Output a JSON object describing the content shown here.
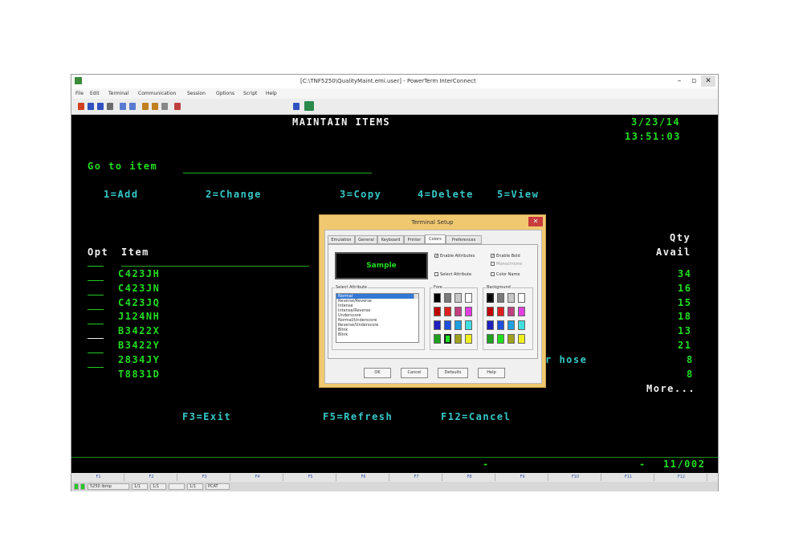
{
  "window": {
    "title": "[C:\\TNF5250\\QualityMaint.emi.user] - PowerTerm InterConnect",
    "minimize_glyph": "–",
    "restore_glyph": "▫",
    "close_glyph": "✕"
  },
  "menubar": [
    "File",
    "Edit",
    "Terminal",
    "Communication",
    "Session",
    "Options",
    "Script",
    "Help"
  ],
  "toolbar": {
    "buttons": [
      {
        "icon": "open-icon",
        "color": "#d04020"
      },
      {
        "icon": "connect-icon",
        "color": "#3050c0"
      },
      {
        "icon": "disconnect-icon",
        "color": "#3050c0"
      },
      {
        "icon": "print-icon",
        "color": "#6a6a6a"
      },
      {
        "icon": "copy-icon",
        "color": "#5a7ad0"
      },
      {
        "icon": "paste-icon",
        "color": "#5a7ad0"
      },
      {
        "icon": "receive-file-icon",
        "color": "#c08020"
      },
      {
        "icon": "send-file-icon",
        "color": "#c08020"
      },
      {
        "icon": "transfer-icon",
        "color": "#888888"
      },
      {
        "icon": "settings-icon",
        "color": "#c04040"
      },
      {
        "icon": "macro-icon",
        "color": "#3050c0"
      },
      {
        "icon": "keyboard-map-icon",
        "color": "#2a8a4a"
      }
    ]
  },
  "screen": {
    "title": "MAINTAIN ITEMS",
    "date": "3/23/14",
    "time": "13:51:03",
    "position_label": "Go to item",
    "options": [
      "1=Add",
      "2=Change",
      "3=Copy",
      "4=Delete",
      "5=View"
    ],
    "header_opt": "Opt",
    "header_item": "Item",
    "header_qty": "Qty",
    "header_avail": "Avail",
    "rows": [
      {
        "item": "C423JH",
        "qty": "34"
      },
      {
        "item": "C423JN",
        "qty": "16"
      },
      {
        "item": "C423JQ",
        "qty": "15"
      },
      {
        "item": "J124NH",
        "qty": "18"
      },
      {
        "item": "B3422X",
        "qty": "13"
      },
      {
        "item": "B3422Y",
        "qty": "21"
      },
      {
        "item": "2834JY",
        "qty": "8"
      },
      {
        "item": "T8831D",
        "qty": "8"
      }
    ],
    "partial_desc": "r hose",
    "more": "More...",
    "fkey_exit": "F3=Exit",
    "fkey_refresh": "F5=Refresh",
    "fkey_cancel": "F12=Cancel",
    "status_dash1": "-",
    "status_dash2": "-",
    "status_position": "11/002"
  },
  "fkey_bar": [
    "F1",
    "F2",
    "F3",
    "F4",
    "F5",
    "F6",
    "F7",
    "F8",
    "F9",
    "F10",
    "F11",
    "F12"
  ],
  "statusbar": [
    "5250 ibmp",
    "1/1",
    "1/1",
    "",
    "1/1",
    "PCAT"
  ],
  "dialog": {
    "title": "Terminal Setup",
    "close_glyph": "✕",
    "tabs": [
      "Emulation",
      "General",
      "Keyboard",
      "Printer",
      "Colors",
      "Preferences"
    ],
    "active_tab": "Colors",
    "sample_label": "Sample",
    "checkboxes": [
      "Enable Attributes",
      "Enable Bold",
      "Monochrome",
      "Select Attribute",
      "Color Name"
    ],
    "attr_group_label": "Select Attribute",
    "attributes": [
      "Normal",
      "Reverse/Reverse",
      "Intense",
      "Intense/Reverse",
      "Underscore",
      "Normal/Underscore",
      "Reverse/Underscore",
      "Blink",
      "Blink"
    ],
    "fore_label": "Fore",
    "back_label": "Background",
    "palette": [
      "#000000",
      "#7a7a7a",
      "#c8c8c8",
      "#ffffff",
      "#c00000",
      "#e02020",
      "#c04080",
      "#e040e0",
      "#2020c0",
      "#2050e0",
      "#20a0e0",
      "#40e0e0",
      "#20a020",
      "#20e020",
      "#a0a020",
      "#f0f020"
    ],
    "buttons": [
      "OK",
      "Cancel",
      "Defaults",
      "Help"
    ]
  }
}
